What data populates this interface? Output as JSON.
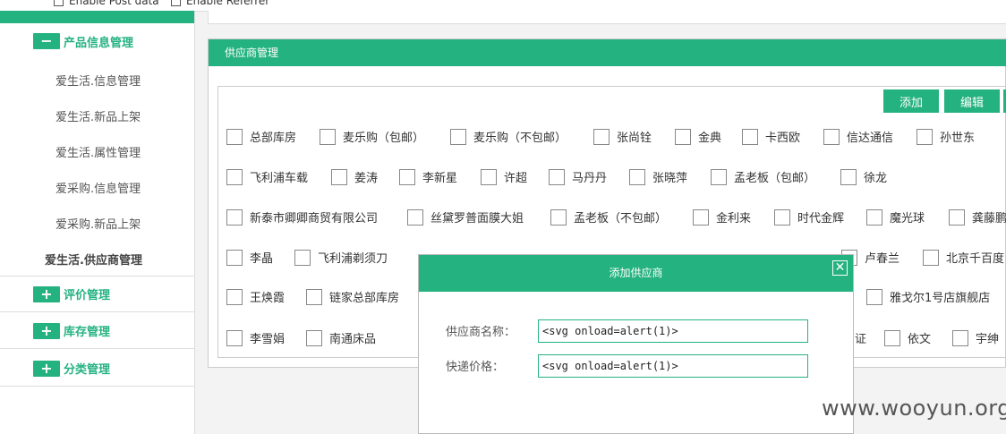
{
  "top": {
    "enable_post": "Enable Post data",
    "enable_referrer": "Enable Referrer"
  },
  "sidebar": {
    "groups": [
      {
        "title": "产品信息管理",
        "toggle": "−"
      },
      {
        "title": "评价管理",
        "toggle": "+"
      },
      {
        "title": "库存管理",
        "toggle": "+"
      },
      {
        "title": "分类管理",
        "toggle": "+"
      }
    ],
    "subitems": [
      "爱生活.信息管理",
      "爱生活.新品上架",
      "爱生活.属性管理",
      "爱采购.信息管理",
      "爱采购.新品上架",
      "爱生活.供应商管理"
    ]
  },
  "panel": {
    "title": "供应商管理",
    "buttons": {
      "add": "添加",
      "edit": "编辑"
    },
    "rows": [
      [
        "总部库房",
        "麦乐购（包邮）",
        "麦乐购（不包邮）",
        "张尚铨",
        "金典",
        "卡西欧",
        "信达通信",
        "孙世东"
      ],
      [
        "飞利浦车载",
        "姜涛",
        "李新星",
        "许超",
        "马丹丹",
        "张晓萍",
        "孟老板（包邮）",
        "徐龙"
      ],
      [
        "新泰市卿卿商贸有限公司",
        "丝黛罗普面膜大姐",
        "孟老板（不包邮）",
        "金利来",
        "时代金辉",
        "魔光球",
        "龚藤鹏"
      ],
      [
        "李晶",
        "飞利浦剃须刀",
        "卢春兰",
        "北京千百度"
      ],
      [
        "王焕霞",
        "链家总部库房",
        "雅戈尔1号店旗舰店"
      ],
      [
        "李雪娟",
        "南通床品",
        "证",
        "依文",
        "宇绅"
      ]
    ]
  },
  "modal": {
    "title": "添加供应商",
    "close": "✕",
    "name_label": "供应商名称：",
    "name_value": "<svg onload=alert(1)>",
    "price_label": "快递价格：",
    "price_value": "<svg onload=alert(1)>"
  },
  "watermark": "www.wooyun.org",
  "colors": {
    "accent": "#25b281"
  }
}
